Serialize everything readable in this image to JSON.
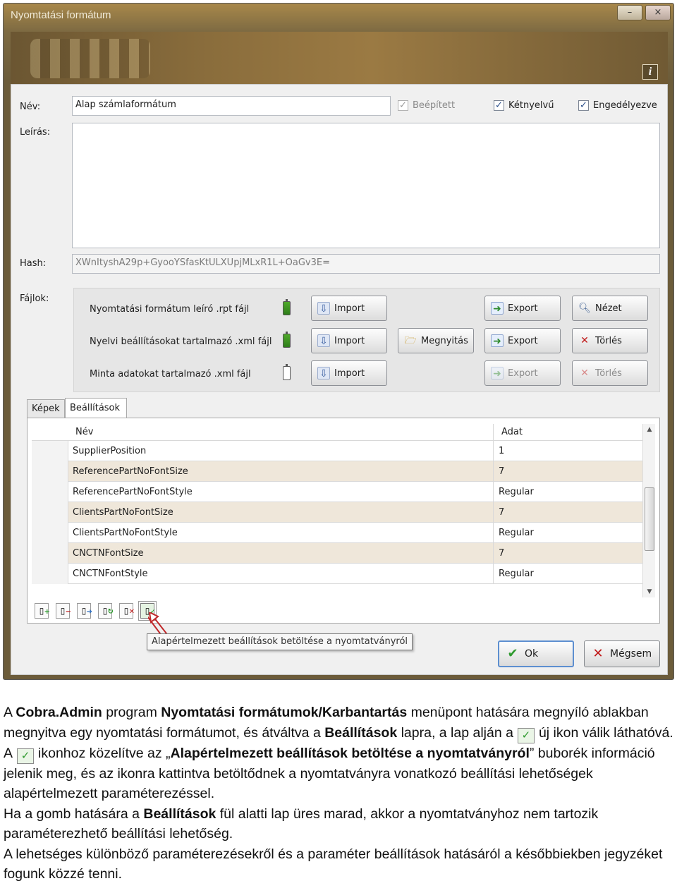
{
  "window": {
    "title": "Nyomtatási formátum",
    "min_glyph": "–",
    "close_glyph": "×",
    "info_glyph": "i"
  },
  "form": {
    "name_label": "Név:",
    "name_value": "Alap számlaformátum",
    "desc_label": "Leírás:",
    "desc_value": "",
    "hash_label": "Hash:",
    "hash_value": "XWnItyshA29p+GyooYSfasKtULXUpjMLxR1L+OaGv3E=",
    "files_label": "Fájlok:",
    "checkboxes": [
      {
        "label": "Beépített",
        "checked": true,
        "disabled": true
      },
      {
        "label": "Kétnyelvű",
        "checked": true,
        "disabled": false
      },
      {
        "label": "Engedélyezve",
        "checked": true,
        "disabled": false
      }
    ]
  },
  "files": [
    {
      "label": "Nyomtatási formátum leíró .rpt fájl",
      "battery": "full",
      "buttons": [
        {
          "label": "Import",
          "icon": "import-icon"
        },
        {
          "label": "Export",
          "icon": "export-icon"
        },
        {
          "label": "Nézet",
          "icon": "view-icon"
        }
      ]
    },
    {
      "label": "Nyelvi beállításokat tartalmazó .xml fájl",
      "battery": "full",
      "buttons": [
        {
          "label": "Import",
          "icon": "import-icon"
        },
        {
          "label": "Megnyitás",
          "icon": "folder-open-icon"
        },
        {
          "label": "Export",
          "icon": "export-icon"
        },
        {
          "label": "Törlés",
          "icon": "delete-icon"
        }
      ]
    },
    {
      "label": "Minta adatokat tartalmazó .xml fájl",
      "battery": "empty",
      "buttons": [
        {
          "label": "Import",
          "icon": "import-icon"
        },
        {
          "label": "Export",
          "icon": "export-icon"
        },
        {
          "label": "Törlés",
          "icon": "delete-icon"
        }
      ]
    }
  ],
  "tabs": [
    "Képek",
    "Beállítások"
  ],
  "grid": {
    "col_name": "Név",
    "col_value": "Adat",
    "rows": [
      {
        "name": "SupplierPosition",
        "value": "1"
      },
      {
        "name": "ReferencePartNoFontSize",
        "value": "7"
      },
      {
        "name": "ReferencePartNoFontStyle",
        "value": "Regular"
      },
      {
        "name": "ClientsPartNoFontSize",
        "value": "7"
      },
      {
        "name": "ClientsPartNoFontStyle",
        "value": "Regular"
      },
      {
        "name": "CNCTNFontSize",
        "value": "7"
      },
      {
        "name": "CNCTNFontStyle",
        "value": "Regular"
      }
    ]
  },
  "tooltip": "Alapértelmezett beállítások betöltése a nyomtatványról",
  "dialog_buttons": {
    "ok": "Ok",
    "cancel": "Mégsem"
  },
  "paragraph": {
    "p1_a": "A ",
    "p1_b": "Cobra.Admin",
    "p1_c": " program ",
    "p1_d": "Nyomtatási formátumok/Karbantartás",
    "p1_e": " menüpont hatására megnyíló ablakban megnyitva egy nyomtatási formátumot, és átváltva a ",
    "p1_f": "Beállítások",
    "p1_g": " lapra, a lap alján a",
    "p1_h": "új ikon válik láthatóvá. A",
    "p1_i": "ikonhoz közelítve az „",
    "p1_j": "Alapértelmezett beállítások betöltése a nyomtatványról",
    "p1_k": "” buborék információ jelenik meg, és az ikonra kattintva betöltődnek a nyomtatványra vonatkozó beállítási lehetőségek alapértelmezett paraméterezéssel.",
    "p2_a": "Ha a gomb hatására a ",
    "p2_b": "Beállítások",
    "p2_c": " fül alatti lap üres marad, akkor a nyomtatványhoz nem tartozik paraméterezhető beállítási lehetőség.",
    "p3": "A lehetséges különböző paraméterezésekről és a paraméter beállítások hatásáról a későbbiekben jegyzéket fogunk közzé tenni."
  }
}
